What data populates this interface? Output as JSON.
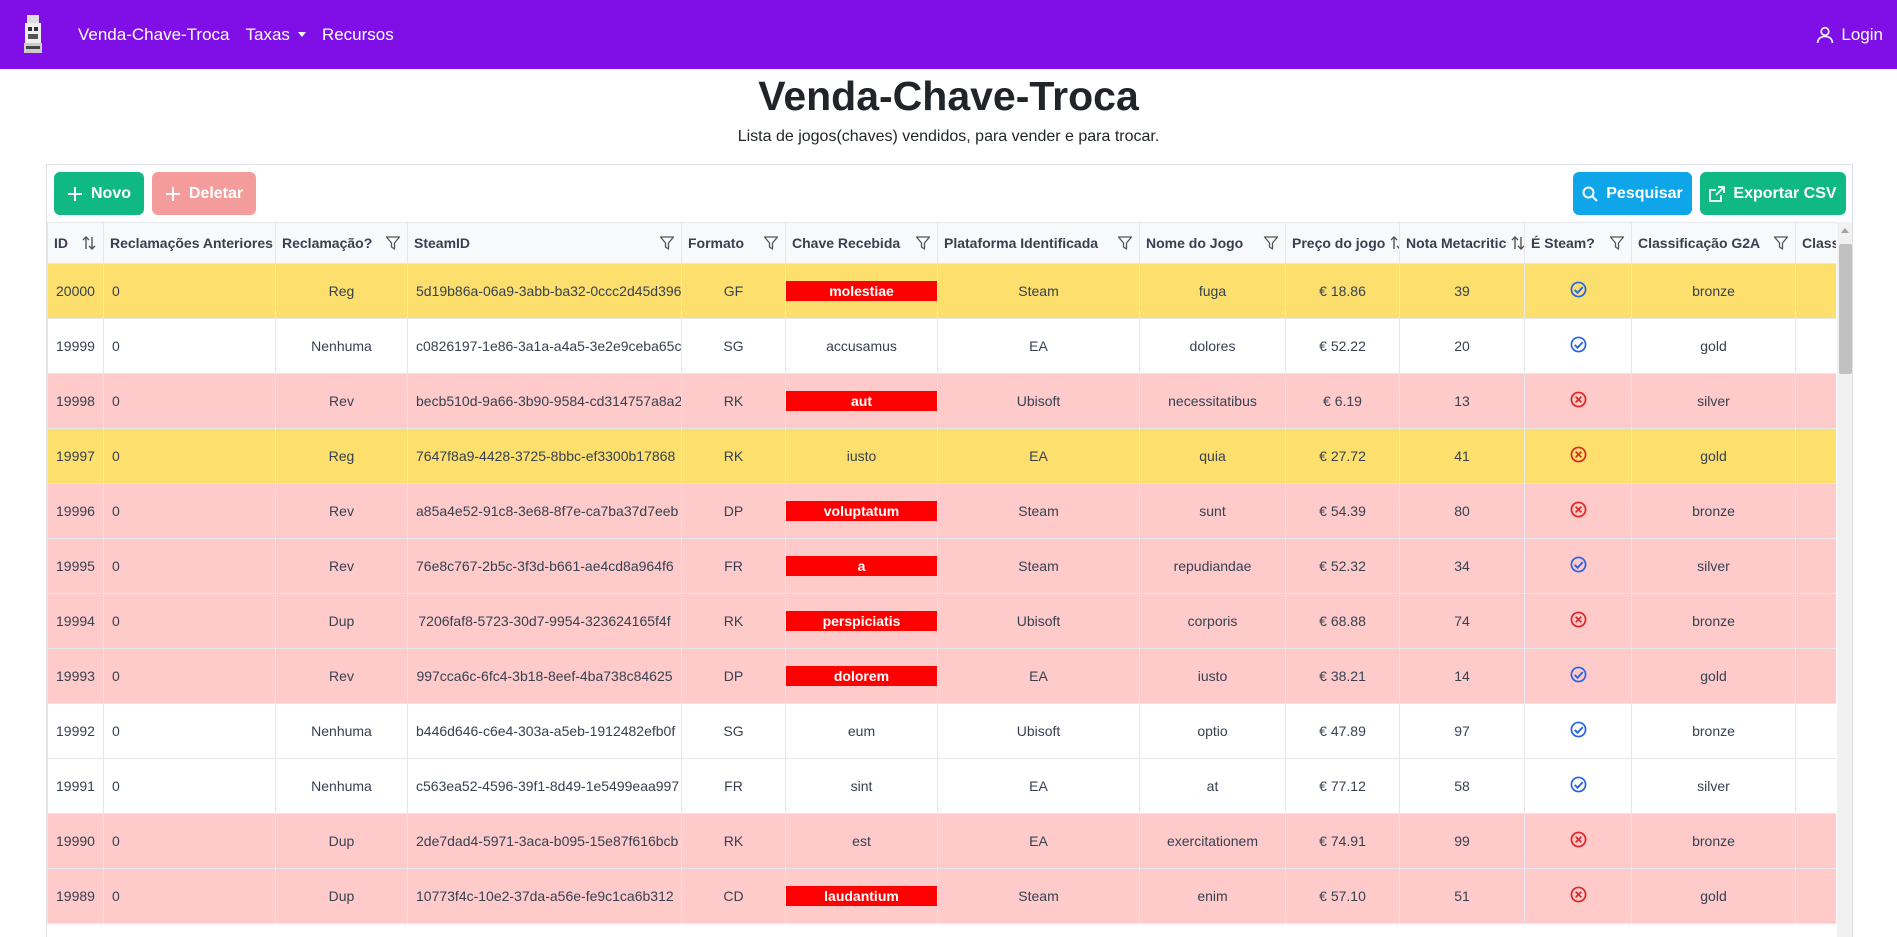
{
  "navbar": {
    "brand": "Venda-Chave-Troca",
    "taxas": "Taxas",
    "recursos": "Recursos",
    "login": "Login",
    "bg_color": "#7f0fe6"
  },
  "header": {
    "title": "Venda-Chave-Troca",
    "subtitle": "Lista de jogos(chaves) vendidos, para vender e para trocar."
  },
  "toolbar": {
    "novo": "Novo",
    "deletar": "Deletar",
    "pesquisar": "Pesquisar",
    "exportar": "Exportar CSV"
  },
  "table": {
    "columns": [
      "ID",
      "Reclamações Anteriores",
      "Reclamação?",
      "SteamID",
      "Formato",
      "Chave Recebida",
      "Plataforma Identificada",
      "Nome do Jogo",
      "Preço do jogo",
      "Nota Metacritic",
      "É Steam?",
      "Classificação G2A",
      "Classif"
    ],
    "rows": [
      {
        "id": "20000",
        "prev": "0",
        "recl": "Reg",
        "steamid": "5d19b86a-06a9-3abb-ba32-0ccc2d45d396",
        "formato": "GF",
        "chave": "molestiae",
        "chave_red": true,
        "plataforma": "Steam",
        "nome": "fuga",
        "preco": "€ 18.86",
        "nota": "39",
        "steam": true,
        "g2a": "bronze",
        "color": "yellow"
      },
      {
        "id": "19999",
        "prev": "0",
        "recl": "Nenhuma",
        "steamid": "c0826197-1e86-3a1a-a4a5-3e2e9ceba65c",
        "formato": "SG",
        "chave": "accusamus",
        "chave_red": false,
        "plataforma": "EA",
        "nome": "dolores",
        "preco": "€ 52.22",
        "nota": "20",
        "steam": true,
        "g2a": "gold",
        "color": "white"
      },
      {
        "id": "19998",
        "prev": "0",
        "recl": "Rev",
        "steamid": "becb510d-9a66-3b90-9584-cd314757a8a2",
        "formato": "RK",
        "chave": "aut",
        "chave_red": true,
        "plataforma": "Ubisoft",
        "nome": "necessitatibus",
        "preco": "€ 6.19",
        "nota": "13",
        "steam": false,
        "g2a": "silver",
        "color": "pink"
      },
      {
        "id": "19997",
        "prev": "0",
        "recl": "Reg",
        "steamid": "7647f8a9-4428-3725-8bbc-ef3300b17868",
        "formato": "RK",
        "chave": "iusto",
        "chave_red": false,
        "plataforma": "EA",
        "nome": "quia",
        "preco": "€ 27.72",
        "nota": "41",
        "steam": false,
        "g2a": "gold",
        "color": "yellow"
      },
      {
        "id": "19996",
        "prev": "0",
        "recl": "Rev",
        "steamid": "a85a4e52-91c8-3e68-8f7e-ca7ba37d7eeb",
        "formato": "DP",
        "chave": "voluptatum",
        "chave_red": true,
        "plataforma": "Steam",
        "nome": "sunt",
        "preco": "€ 54.39",
        "nota": "80",
        "steam": false,
        "g2a": "bronze",
        "color": "pink"
      },
      {
        "id": "19995",
        "prev": "0",
        "recl": "Rev",
        "steamid": "76e8c767-2b5c-3f3d-b661-ae4cd8a964f6",
        "formato": "FR",
        "chave": "a",
        "chave_red": true,
        "plataforma": "Steam",
        "nome": "repudiandae",
        "preco": "€ 52.32",
        "nota": "34",
        "steam": true,
        "g2a": "silver",
        "color": "pink"
      },
      {
        "id": "19994",
        "prev": "0",
        "recl": "Dup",
        "steamid": "7206faf8-5723-30d7-9954-323624165f4f",
        "formato": "RK",
        "chave": "perspiciatis",
        "chave_red": true,
        "plataforma": "Ubisoft",
        "nome": "corporis",
        "preco": "€ 68.88",
        "nota": "74",
        "steam": false,
        "g2a": "bronze",
        "color": "pink"
      },
      {
        "id": "19993",
        "prev": "0",
        "recl": "Rev",
        "steamid": "997cca6c-6fc4-3b18-8eef-4ba738c84625",
        "formato": "DP",
        "chave": "dolorem",
        "chave_red": true,
        "plataforma": "EA",
        "nome": "iusto",
        "preco": "€ 38.21",
        "nota": "14",
        "steam": true,
        "g2a": "gold",
        "color": "pink"
      },
      {
        "id": "19992",
        "prev": "0",
        "recl": "Nenhuma",
        "steamid": "b446d646-c6e4-303a-a5eb-1912482efb0f",
        "formato": "SG",
        "chave": "eum",
        "chave_red": false,
        "plataforma": "Ubisoft",
        "nome": "optio",
        "preco": "€ 47.89",
        "nota": "97",
        "steam": true,
        "g2a": "bronze",
        "color": "white"
      },
      {
        "id": "19991",
        "prev": "0",
        "recl": "Nenhuma",
        "steamid": "c563ea52-4596-39f1-8d49-1e5499eaa997",
        "formato": "FR",
        "chave": "sint",
        "chave_red": false,
        "plataforma": "EA",
        "nome": "at",
        "preco": "€ 77.12",
        "nota": "58",
        "steam": true,
        "g2a": "silver",
        "color": "white"
      },
      {
        "id": "19990",
        "prev": "0",
        "recl": "Dup",
        "steamid": "2de7dad4-5971-3aca-b095-15e87f616bcb",
        "formato": "RK",
        "chave": "est",
        "chave_red": false,
        "plataforma": "EA",
        "nome": "exercitationem",
        "preco": "€ 74.91",
        "nota": "99",
        "steam": false,
        "g2a": "bronze",
        "color": "pink"
      },
      {
        "id": "19989",
        "prev": "0",
        "recl": "Dup",
        "steamid": "10773f4c-10e2-37da-a56e-fe9c1ca6b312",
        "formato": "CD",
        "chave": "laudantium",
        "chave_red": true,
        "plataforma": "Steam",
        "nome": "enim",
        "preco": "€ 57.10",
        "nota": "51",
        "steam": false,
        "g2a": "gold",
        "color": "pink"
      }
    ]
  }
}
